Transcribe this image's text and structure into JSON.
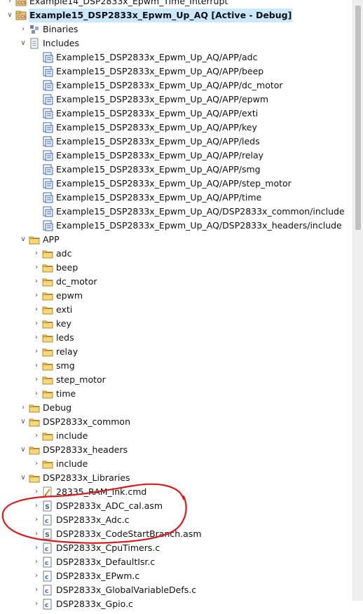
{
  "project_tree": {
    "top_partial_label": "Example14_DSP2833x_Epwm_Time_Interrupt",
    "items": [
      {
        "label": "Example14_DSP2833x_Epwm_Time_Interrupt",
        "depth": 0,
        "expanded": false,
        "icon": "project-icon",
        "partial": true
      },
      {
        "label": "Example15_DSP2833x_Epwm_Up_AQ  [Active - Debug]",
        "depth": 0,
        "expanded": true,
        "icon": "project-icon",
        "selected": true,
        "bold": true
      },
      {
        "label": "Binaries",
        "depth": 1,
        "expanded": false,
        "icon": "binaries-icon"
      },
      {
        "label": "Includes",
        "depth": 1,
        "expanded": true,
        "icon": "includes-icon"
      },
      {
        "label": "Example15_DSP2833x_Epwm_Up_AQ/APP/adc",
        "depth": 2,
        "icon": "include-path-icon"
      },
      {
        "label": "Example15_DSP2833x_Epwm_Up_AQ/APP/beep",
        "depth": 2,
        "icon": "include-path-icon"
      },
      {
        "label": "Example15_DSP2833x_Epwm_Up_AQ/APP/dc_motor",
        "depth": 2,
        "icon": "include-path-icon"
      },
      {
        "label": "Example15_DSP2833x_Epwm_Up_AQ/APP/epwm",
        "depth": 2,
        "icon": "include-path-icon"
      },
      {
        "label": "Example15_DSP2833x_Epwm_Up_AQ/APP/exti",
        "depth": 2,
        "icon": "include-path-icon"
      },
      {
        "label": "Example15_DSP2833x_Epwm_Up_AQ/APP/key",
        "depth": 2,
        "icon": "include-path-icon"
      },
      {
        "label": "Example15_DSP2833x_Epwm_Up_AQ/APP/leds",
        "depth": 2,
        "icon": "include-path-icon"
      },
      {
        "label": "Example15_DSP2833x_Epwm_Up_AQ/APP/relay",
        "depth": 2,
        "icon": "include-path-icon"
      },
      {
        "label": "Example15_DSP2833x_Epwm_Up_AQ/APP/smg",
        "depth": 2,
        "icon": "include-path-icon"
      },
      {
        "label": "Example15_DSP2833x_Epwm_Up_AQ/APP/step_motor",
        "depth": 2,
        "icon": "include-path-icon"
      },
      {
        "label": "Example15_DSP2833x_Epwm_Up_AQ/APP/time",
        "depth": 2,
        "icon": "include-path-icon"
      },
      {
        "label": "Example15_DSP2833x_Epwm_Up_AQ/DSP2833x_common/include",
        "depth": 2,
        "icon": "include-path-icon"
      },
      {
        "label": "Example15_DSP2833x_Epwm_Up_AQ/DSP2833x_headers/include",
        "depth": 2,
        "icon": "include-path-icon"
      },
      {
        "label": "APP",
        "depth": 1,
        "expanded": true,
        "icon": "folder-icon"
      },
      {
        "label": "adc",
        "depth": 2,
        "expanded": false,
        "icon": "folder-icon"
      },
      {
        "label": "beep",
        "depth": 2,
        "expanded": false,
        "icon": "folder-icon"
      },
      {
        "label": "dc_motor",
        "depth": 2,
        "expanded": false,
        "icon": "folder-icon"
      },
      {
        "label": "epwm",
        "depth": 2,
        "expanded": false,
        "icon": "folder-icon"
      },
      {
        "label": "exti",
        "depth": 2,
        "expanded": false,
        "icon": "folder-icon"
      },
      {
        "label": "key",
        "depth": 2,
        "expanded": false,
        "icon": "folder-icon"
      },
      {
        "label": "leds",
        "depth": 2,
        "expanded": false,
        "icon": "folder-icon"
      },
      {
        "label": "relay",
        "depth": 2,
        "expanded": false,
        "icon": "folder-icon"
      },
      {
        "label": "smg",
        "depth": 2,
        "expanded": false,
        "icon": "folder-icon"
      },
      {
        "label": "step_motor",
        "depth": 2,
        "expanded": false,
        "icon": "folder-icon"
      },
      {
        "label": "time",
        "depth": 2,
        "expanded": false,
        "icon": "folder-icon"
      },
      {
        "label": "Debug",
        "depth": 1,
        "expanded": false,
        "icon": "folder-icon"
      },
      {
        "label": "DSP2833x_common",
        "depth": 1,
        "expanded": true,
        "icon": "folder-icon"
      },
      {
        "label": "include",
        "depth": 2,
        "expanded": false,
        "icon": "folder-icon"
      },
      {
        "label": "DSP2833x_headers",
        "depth": 1,
        "expanded": true,
        "icon": "folder-icon"
      },
      {
        "label": "include",
        "depth": 2,
        "expanded": false,
        "icon": "folder-icon"
      },
      {
        "label": "DSP2833x_Libraries",
        "depth": 1,
        "expanded": true,
        "icon": "folder-icon"
      },
      {
        "label": "28335_RAM_lnk.cmd",
        "depth": 2,
        "expanded": false,
        "icon": "cmd-file-icon"
      },
      {
        "label": "DSP2833x_ADC_cal.asm",
        "depth": 2,
        "expanded": false,
        "icon": "asm-file-icon"
      },
      {
        "label": "DSP2833x_Adc.c",
        "depth": 2,
        "expanded": false,
        "icon": "c-file-icon"
      },
      {
        "label": "DSP2833x_CodeStartBranch.asm",
        "depth": 2,
        "expanded": false,
        "icon": "asm-file-icon"
      },
      {
        "label": "DSP2833x_CpuTimers.c",
        "depth": 2,
        "expanded": false,
        "icon": "c-file-icon"
      },
      {
        "label": "DSP2833x_DefaultIsr.c",
        "depth": 2,
        "expanded": false,
        "icon": "c-file-icon"
      },
      {
        "label": "DSP2833x_EPwm.c",
        "depth": 2,
        "expanded": false,
        "icon": "c-file-icon"
      },
      {
        "label": "DSP2833x_GlobalVariableDefs.c",
        "depth": 2,
        "expanded": false,
        "icon": "c-file-icon"
      },
      {
        "label": "DSP2833x_Gpio.c",
        "depth": 2,
        "expanded": false,
        "icon": "c-file-icon",
        "partial": true
      }
    ]
  },
  "annotation_color": "#e01818",
  "selection_color": "#cce8ff"
}
